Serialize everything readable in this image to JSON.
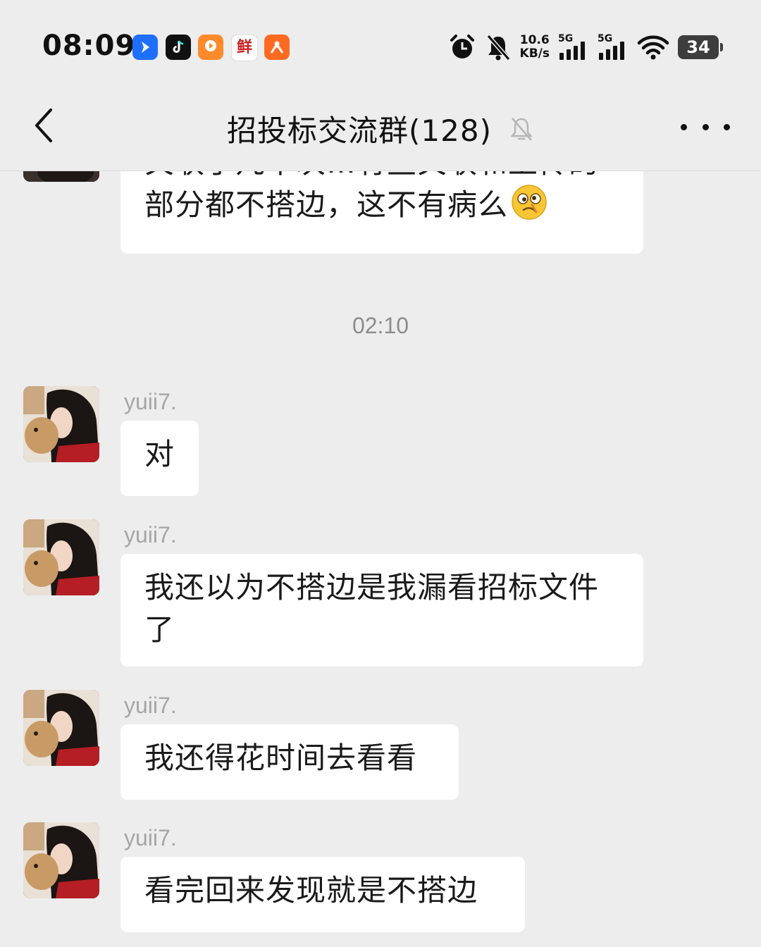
{
  "status_bar": {
    "time": "08:09",
    "net_speed_value": "10.6",
    "net_speed_unit": "KB/s",
    "signal_1_label": "5G",
    "signal_2_label": "5G",
    "battery_level": "34",
    "app_icons": [
      {
        "name": "feishu-app-icon",
        "color": "#1f6fff",
        "glyph": "❯"
      },
      {
        "name": "douyin-app-icon",
        "color": "#111111",
        "glyph": "♪"
      },
      {
        "name": "video-app-icon",
        "color": "#ff8a2b",
        "glyph": "▶"
      },
      {
        "name": "xianyu-app-icon",
        "color": "#ffffff",
        "glyph": "鲜"
      },
      {
        "name": "taobao-app-icon",
        "color": "#ff6a22",
        "glyph": "✿"
      }
    ]
  },
  "header": {
    "title": "招投标交流群(128)",
    "muted": true
  },
  "chat": {
    "partial_message": {
      "line1": "关联了几千次…有些关联和上传的",
      "line2": "部分都不搭边，这不有病么",
      "emoji": "dizzy-face-emoji"
    },
    "time_divider": "02:10",
    "messages": [
      {
        "sender": "yuii7.",
        "text": "对"
      },
      {
        "sender": "yuii7.",
        "text_line1": "我还以为不搭边是我漏看招标文件",
        "text_line2": "了"
      },
      {
        "sender": "yuii7.",
        "text": "我还得花时间去看看"
      },
      {
        "sender": "yuii7.",
        "text": "看完回来发现就是不搭边"
      }
    ]
  },
  "colors": {
    "background": "#ededed",
    "bubble": "#ffffff",
    "sender_name": "#a6a6a6",
    "time_divider": "#8c8c8c"
  }
}
